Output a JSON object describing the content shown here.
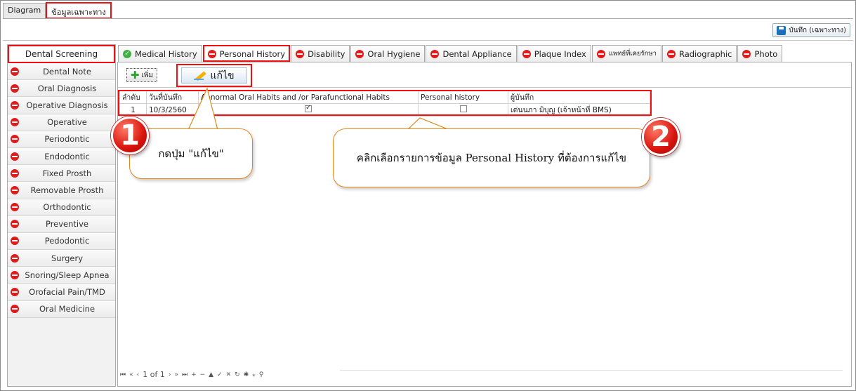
{
  "top_tabs": [
    {
      "label": "Diagram"
    },
    {
      "label": "ข้อมูลเฉพาะทาง"
    }
  ],
  "toolbar": {
    "save_label": "บันทึก (เฉพาะทาง)"
  },
  "sidebar": {
    "header": "Dental Screening",
    "items": [
      {
        "label": "Dental Note"
      },
      {
        "label": "Oral Diagnosis"
      },
      {
        "label": "Operative Diagnosis"
      },
      {
        "label": "Operative"
      },
      {
        "label": "Periodontic"
      },
      {
        "label": "Endodontic"
      },
      {
        "label": "Fixed Prosth"
      },
      {
        "label": "Removable Prosth"
      },
      {
        "label": "Orthodontic"
      },
      {
        "label": "Preventive"
      },
      {
        "label": "Pedodontic"
      },
      {
        "label": "Surgery"
      },
      {
        "label": "Snoring/Sleep Apnea"
      },
      {
        "label": "Orofacial Pain/TMD"
      },
      {
        "label": "Oral Medicine"
      }
    ]
  },
  "sub_tabs": [
    {
      "label": "Medical History",
      "status": "ok"
    },
    {
      "label": "Personal History",
      "status": "no"
    },
    {
      "label": "Disability",
      "status": "no"
    },
    {
      "label": "Oral Hygiene",
      "status": "no"
    },
    {
      "label": "Dental Appliance",
      "status": "no"
    },
    {
      "label": "Plaque Index",
      "status": "no"
    },
    {
      "label": "แพทย์ที่เคยรักษา",
      "status": "no"
    },
    {
      "label": "Radiographic",
      "status": "no"
    },
    {
      "label": "Photo",
      "status": "no"
    }
  ],
  "panel": {
    "add_label": "เพิ่ม",
    "edit_label": "แก้ไข"
  },
  "grid": {
    "columns": [
      "ลำดับ",
      "วันที่บันทึก",
      "Abnormal Oral Habits and /or Parafunctional Habits",
      "Personal history",
      "ผู้บันทึก"
    ],
    "rows": [
      {
        "no": "1",
        "date": "10/3/2560",
        "habits": true,
        "personal_history": false,
        "recorder": "เด่นนภา มิบุญ (เจ้าหน้าที่ BMS)"
      }
    ]
  },
  "nav": {
    "page_text": "1 of 1"
  },
  "callouts": [
    {
      "number": "1",
      "text": "กดปุ่ม \"แก้ไข\""
    },
    {
      "number": "2",
      "text": "คลิกเลือกรายการข้อมูล Personal History ที่ต้องการแก้ไข"
    }
  ],
  "colors": {
    "accent_red": "#e11111",
    "callout_border": "#e1871c",
    "ok_green": "#43b043"
  }
}
